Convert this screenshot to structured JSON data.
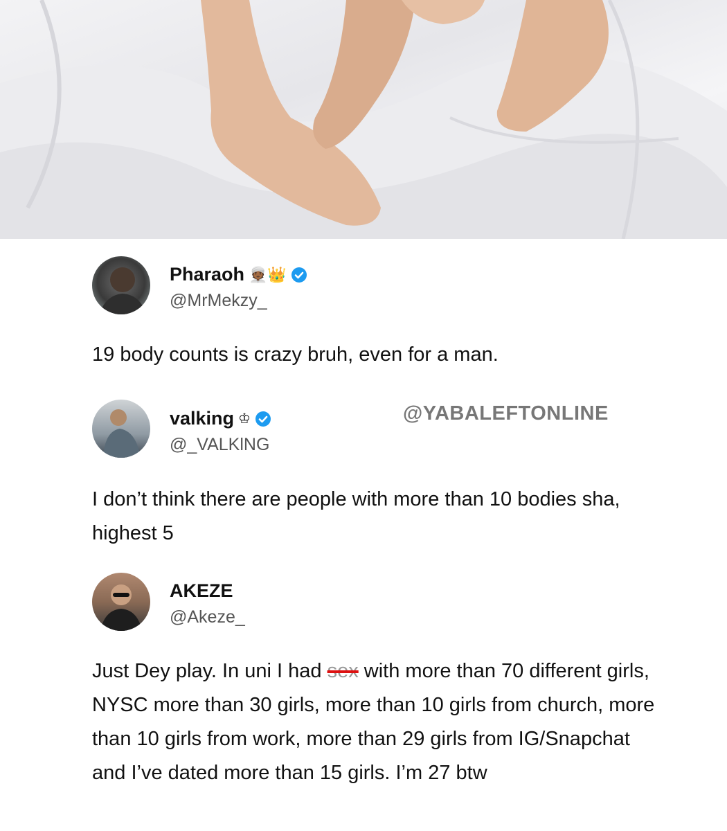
{
  "photo": {
    "description_icon": "bed-sheet-feet-photo"
  },
  "watermark": "@YABALEFTONLINE",
  "tweets": [
    {
      "name": "Pharaoh",
      "name_emojis": "👳🏾👑",
      "handle": "@MrMekzy_",
      "verified": true,
      "text": "19 body counts is crazy bruh, even for a man."
    },
    {
      "name": "valking",
      "name_emojis": "♔",
      "handle": "@_VALKlNG",
      "verified": true,
      "text": "I don’t think there are people with more than 10 bodies sha, highest 5"
    },
    {
      "name": "AKEZE",
      "handle": "@Akeze_",
      "verified": false,
      "text_before": "Just Dey play. In uni I had ",
      "text_struck": "sex",
      "text_after": " with more than 70 different girls, NYSC more than 30 girls, more than 10 girls from church, more than 10 girls from work, more than 29 girls from IG/Snapchat and I’ve dated more than 15 girls. I’m 27 btw"
    }
  ],
  "colors": {
    "verified": "#1d9bf0",
    "watermark": "#777777",
    "strike": "#dd1111"
  }
}
